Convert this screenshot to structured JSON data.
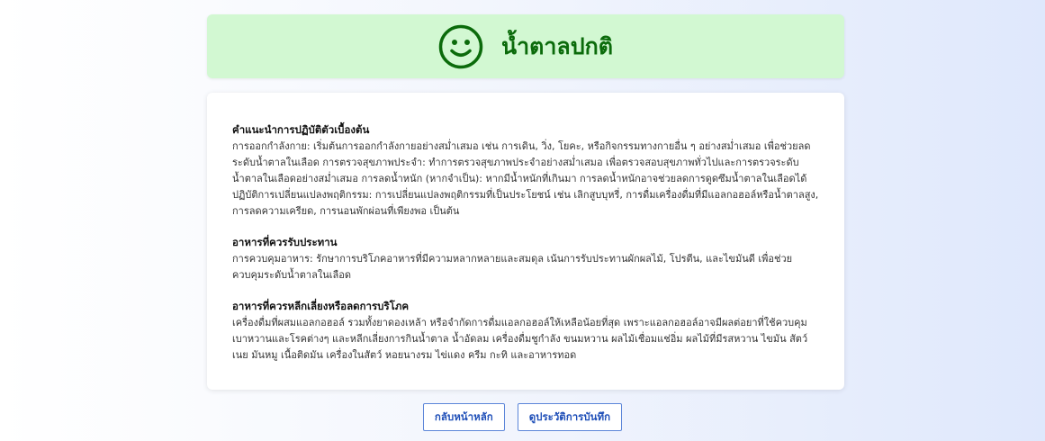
{
  "result": {
    "title": "น้ำตาลปกติ",
    "icon": "smiley-face-icon",
    "status_color": "#0b6b0b",
    "banner_color": "#d2f8d2"
  },
  "advice": {
    "sections": [
      {
        "heading": "คำแนะนำการปฏิบัติตัวเบื้องต้น",
        "body": "การออกกำลังกาย: เริ่มต้นการออกกำลังกายอย่างสม่ำเสมอ เช่น การเดิน, วิ่ง, โยคะ, หรือกิจกรรมทางกายอื่น ๆ อย่างสม่ำเสมอ เพื่อช่วยลดระดับน้ำตาลในเลือด การตรวจสุขภาพประจำ: ทำการตรวจสุขภาพประจำอย่างสม่ำเสมอ เพื่อตรวจสอบสุขภาพทั่วไปและการตรวจระดับน้ำตาลในเลือดอย่างสม่ำเสมอ การลดน้ำหนัก (หากจำเป็น): หากมีน้ำหนักที่เกินมา การลดน้ำหนักอาจช่วยลดการดูดซึมน้ำตาลในเลือดได้ ปฏิบัติการเปลี่ยนแปลงพฤติกรรม: การเปลี่ยนแปลงพฤติกรรมที่เป็นประโยชน์ เช่น เลิกสูบบุหรี่, การดื่มเครื่องดื่มที่มีแอลกอฮอล์หรือน้ำตาลสูง, การลดความเครียด, การนอนพักผ่อนที่เพียงพอ เป็นต้น"
      },
      {
        "heading": "อาหารที่ควรรับประทาน",
        "body": "การควบคุมอาหาร: รักษาการบริโภคอาหารที่มีความหลากหลายและสมดุล เน้นการรับประทานผักผลไม้, โปรตีน, และไขมันดี เพื่อช่วยควบคุมระดับน้ำตาลในเลือด"
      },
      {
        "heading": "อาหารที่ควรหลีกเลี่ยงหรือลดการบริโภค",
        "body": "เครื่องดื่มที่ผสมแอลกอฮอล์ รวมทั้งยาดองเหล้า หรือจำกัดการดื่มแอลกอฮอล์ให้เหลือน้อยที่สุด เพราะแอลกอฮอล์อาจมีผลต่อยาที่ใช้ควบคุมเบาหวานและโรคต่างๆ และหลีกเลี่ยงการกินน้ำตาล น้ำอัดลม เครื่องดื่มชูกำลัง ขนมหวาน ผลไม้เชื่อมแช่อิ่ม ผลไม้ที่มีรสหวาน ไขมัน สัตว์ เนย มันหมู เนื้อติดมัน เครื่องในสัตว์ หอยนางรม ไข่แดง ครีม กะทิ และอาหารทอด"
      }
    ]
  },
  "actions": {
    "home_label": "กลับหน้าหลัก",
    "history_label": "ดูประวัติการบันทึก",
    "accent_color": "#1f4fb8"
  }
}
